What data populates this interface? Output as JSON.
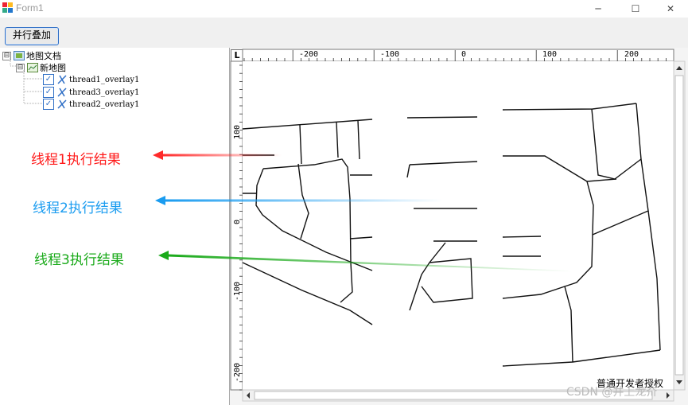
{
  "window": {
    "title": "Form1",
    "minimize_symbol": "─",
    "maximize_symbol": "☐",
    "close_symbol": "✕"
  },
  "toolbar": {
    "parallel_button_label": "并行叠加"
  },
  "tree": {
    "root_label": "地图文档",
    "map_label": "新地图",
    "expander_symbol": "⊟",
    "check_symbol": "✓",
    "layers": [
      {
        "label": "thread1_overlay1",
        "checked": true
      },
      {
        "label": "thread3_overlay1",
        "checked": true
      },
      {
        "label": "thread2_overlay1",
        "checked": true
      }
    ]
  },
  "annotations": [
    {
      "text": "线程1执行结果",
      "color": "#ff1a1a"
    },
    {
      "text": "线程2执行结果",
      "color": "#1a9cf0"
    },
    {
      "text": "线程3执行结果",
      "color": "#1aaa1a"
    }
  ],
  "map": {
    "corner_label": "L",
    "ruler_top_labels": [
      "-200",
      "-100",
      "0",
      "100",
      "200"
    ],
    "ruler_left_labels": [
      "100",
      "0",
      "-100",
      "-200"
    ],
    "license_text": "普通开发者授权"
  },
  "watermark": {
    "text": "CSDN @井上龙夼"
  }
}
